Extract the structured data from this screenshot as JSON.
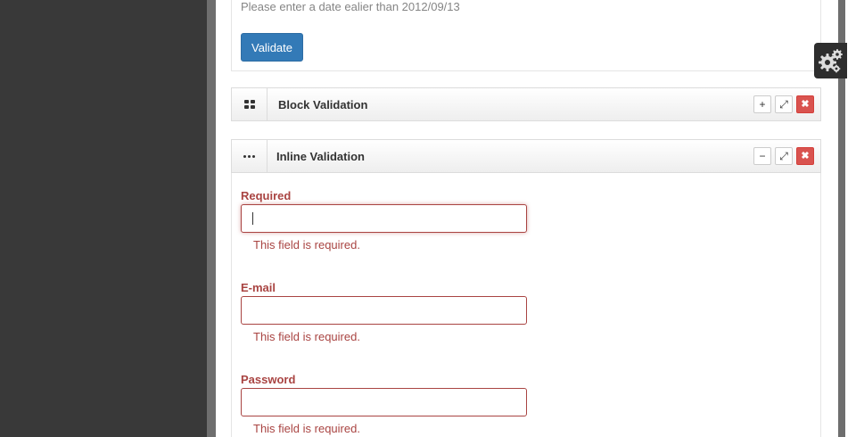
{
  "top_panel": {
    "hint": "Please enter a date ealier than 2012/09/13",
    "validate_label": "Validate"
  },
  "block_validation": {
    "icon": "th-large-icon",
    "title": "Block Validation",
    "tools": {
      "expand": "+",
      "fullscreen": "⤢",
      "close": "✖"
    }
  },
  "inline_validation": {
    "icon": "ellipsis-icon",
    "title": "Inline Validation",
    "tools": {
      "collapse": "−",
      "fullscreen": "⤢",
      "close": "✖"
    },
    "fields": [
      {
        "label": "Required",
        "value": "",
        "error": "This field is required."
      },
      {
        "label": "E-mail",
        "value": "",
        "error": "This field is required."
      },
      {
        "label": "Password",
        "value": "",
        "error": "This field is required."
      }
    ]
  },
  "settings": {
    "icon": "gears-icon"
  },
  "colors": {
    "primary": "#337ab7",
    "danger": "#d9534f",
    "error_text": "#a94442",
    "sidebar": "#393939"
  }
}
